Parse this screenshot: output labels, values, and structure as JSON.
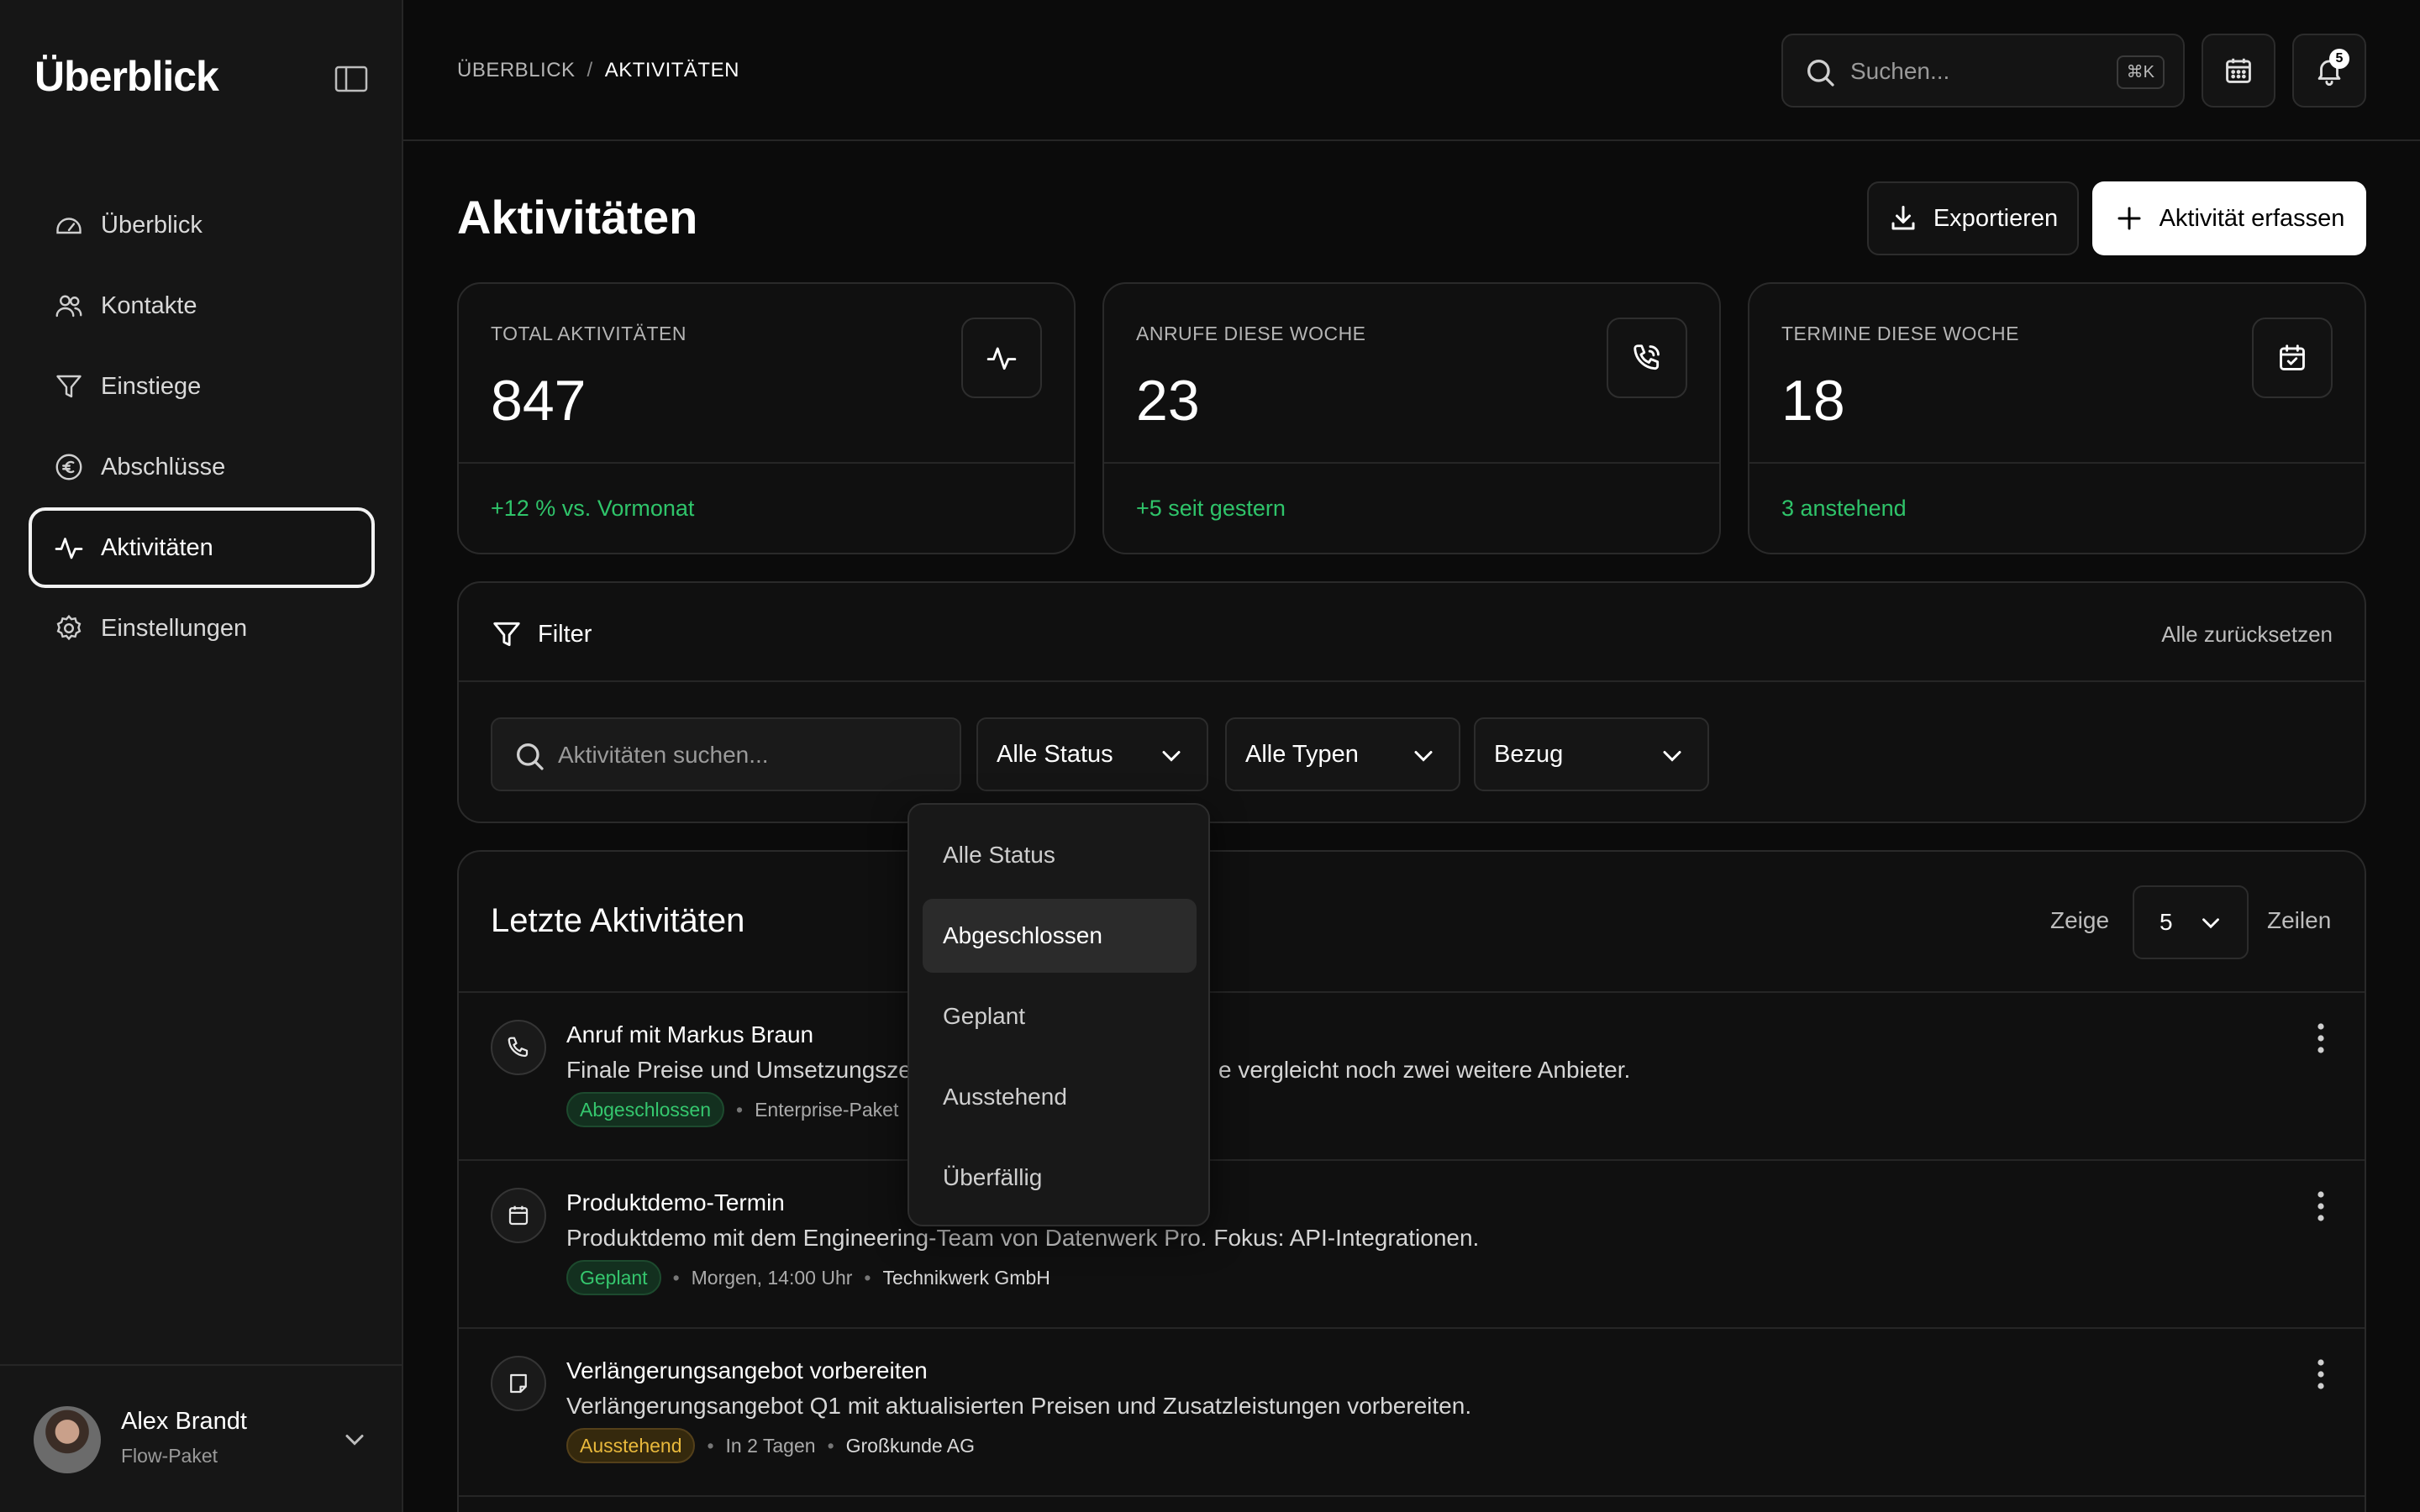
{
  "sidebar": {
    "brand": "Überblick",
    "nav": [
      {
        "label": "Überblick",
        "icon": "gauge-icon"
      },
      {
        "label": "Kontakte",
        "icon": "users-icon"
      },
      {
        "label": "Einstiege",
        "icon": "funnel-icon"
      },
      {
        "label": "Abschlüsse",
        "icon": "euro-icon"
      },
      {
        "label": "Aktivitäten",
        "icon": "activity-icon",
        "active": true
      },
      {
        "label": "Einstellungen",
        "icon": "gear-icon"
      }
    ],
    "user": {
      "name": "Alex Brandt",
      "plan": "Flow-Paket"
    }
  },
  "header": {
    "breadcrumb": [
      "ÜBERBLICK",
      "AKTIVITÄTEN"
    ],
    "breadcrumb_sep": "/",
    "search_placeholder": "Suchen...",
    "search_shortcut": "⌘K",
    "notification_count": "5"
  },
  "page": {
    "title": "Aktivitäten",
    "export_label": "Exportieren",
    "add_label": "Aktivität erfassen"
  },
  "stats": [
    {
      "label": "TOTAL AKTIVITÄTEN",
      "value": "847",
      "trend": "+12 % vs. Vormonat",
      "icon": "activity-icon"
    },
    {
      "label": "ANRUFE DIESE WOCHE",
      "value": "23",
      "trend": "+5 seit gestern",
      "icon": "phone-call-icon"
    },
    {
      "label": "TERMINE DIESE WOCHE",
      "value": "18",
      "trend": "3 anstehend",
      "icon": "calendar-check-icon"
    }
  ],
  "filter": {
    "title": "Filter",
    "reset": "Alle zurücksetzen",
    "search_placeholder": "Aktivitäten suchen...",
    "status": "Alle Status",
    "type": "Alle Typen",
    "relation": "Bezug"
  },
  "status_dropdown": {
    "options": [
      "Alle Status",
      "Abgeschlossen",
      "Geplant",
      "Ausstehend",
      "Überfällig"
    ],
    "highlighted": "Abgeschlossen"
  },
  "activities": {
    "title": "Letzte Aktivitäten",
    "show_label": "Zeige",
    "rows_value": "5",
    "rows_label": "Zeilen",
    "items": [
      {
        "icon": "phone-icon",
        "name": "Anruf mit Markus Braun",
        "desc_left": "Finale Preise und Umsetzungszei",
        "desc_right": "e vergleicht noch zwei weitere Anbieter.",
        "status": "Abgeschlossen",
        "status_color": "green",
        "meta": [
          "Enterprise-Paket"
        ]
      },
      {
        "icon": "calendar-icon",
        "name": "Produktdemo-Termin",
        "desc": "Produktdemo mit dem Engineering-Team von Datenwerk Pro. Fokus: API-Integrationen.",
        "status": "Geplant",
        "status_color": "green",
        "meta": [
          "Morgen, 14:00 Uhr",
          "Technikwerk GmbH"
        ]
      },
      {
        "icon": "note-icon",
        "name": "Verlängerungsangebot vorbereiten",
        "desc": "Verlängerungsangebot Q1 mit aktualisierten Preisen und Zusatzleistungen vorbereiten.",
        "status": "Ausstehend",
        "status_color": "yellow",
        "meta": [
          "In 2 Tagen",
          "Großkunde AG"
        ]
      }
    ]
  }
}
